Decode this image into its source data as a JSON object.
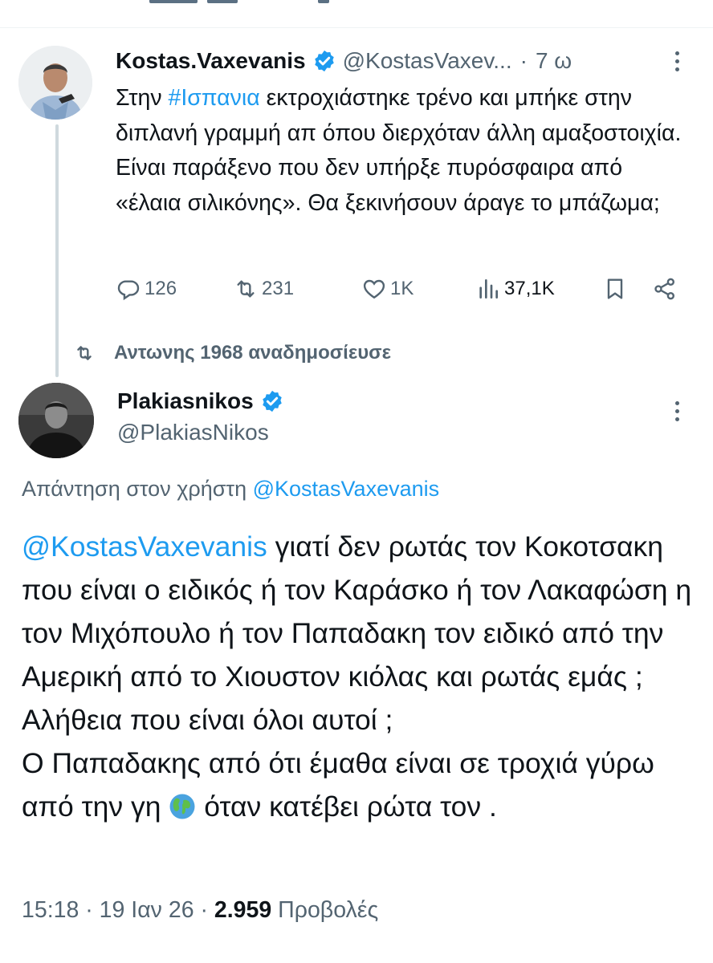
{
  "tweet1": {
    "author_name": "Kostas.Vaxevanis",
    "handle": "@KostasVaxev...",
    "separator": "·",
    "time": "7 ω",
    "hashtag": "#Ισπανια",
    "text_before": "Στην ",
    "text_after": " εκτροχιάστηκε τρένο και μπήκε στην διπλανή γραμμή απ όπου διερχόταν άλλη αμαξοστοιχία. Είναι παράξενο που δεν υπήρξε πυρόσφαιρα από «έλαια σιλικόνης». Θα ξεκινήσουν άραγε το μπάζωμα;",
    "replies": "126",
    "retweets": "231",
    "likes": "1K",
    "views": "37,1K"
  },
  "retweet_notice": {
    "text": "Αντωνης 1968 αναδημοσίευσε"
  },
  "tweet2": {
    "author_name": "Plakiasnikos",
    "handle": "@PlakiasNikos",
    "reply_label": "Απάντηση στον χρήστη ",
    "reply_to": "@KostasVaxevanis",
    "mention": "@KostasVaxevanis",
    "text_part1": " γιατί δεν ρωτάς τον Κοκοτσακη που είναι ο ειδικός ή τον Καράσκο ή τον Λακαφώση η τον Μιχόπουλο ή τον Παπαδακη τον ειδικό από την Αμερική από το Χιουστον κιόλας  και ρωτάς εμάς ;",
    "text_part2": "Αλήθεια που είναι όλοι αυτοί ;",
    "text_part3": "Ο Παπαδακης από ότι έμαθα είναι σε τροχιά γύρω από την γη ",
    "text_part4": " όταν κατέβει ρώτα τον .",
    "time": "15:18",
    "separator": "·",
    "date": "19 Ιαν 26",
    "views_number": "2.959",
    "views_label": "Προβολές"
  },
  "icons": {
    "verified": "verified-badge-icon",
    "more": "more-dots-icon",
    "reply": "reply-icon",
    "retweet": "retweet-icon",
    "like": "heart-icon",
    "views": "views-bar-icon",
    "bookmark": "bookmark-icon",
    "share": "share-icon",
    "globe": "globe-emoji-icon"
  },
  "colors": {
    "accent": "#1d9bf0",
    "text": "#0f1419",
    "muted": "#536471",
    "thread_line": "#cfd9de"
  }
}
